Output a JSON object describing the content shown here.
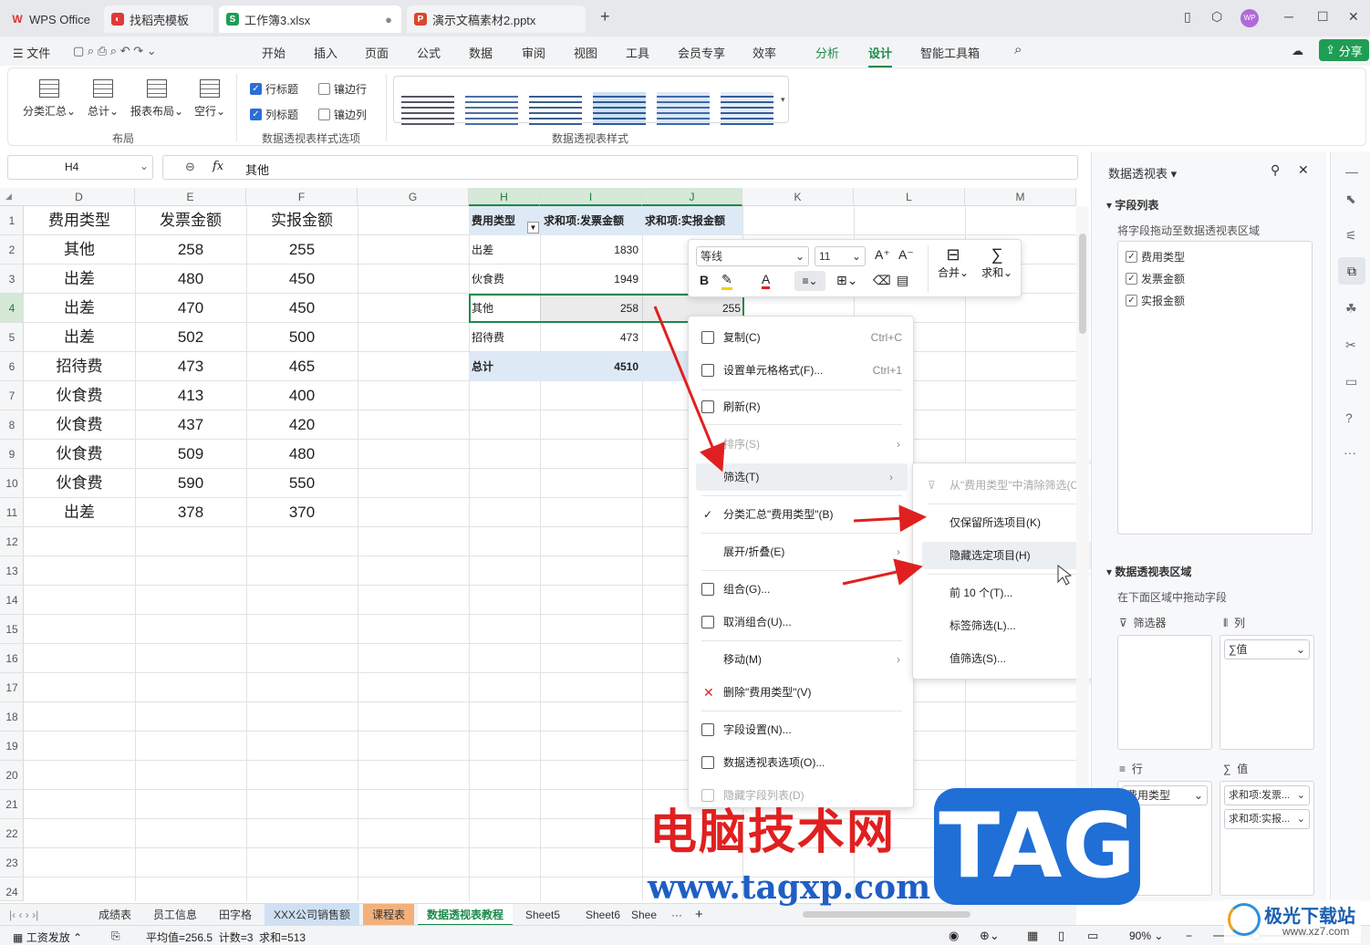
{
  "tabs": [
    {
      "label": "WPS Office"
    },
    {
      "label": "找稻壳模板"
    },
    {
      "label": "工作簿3.xlsx"
    },
    {
      "label": "演示文稿素材2.pptx"
    }
  ],
  "user_badge": "WP",
  "menus": [
    "文件",
    "开始",
    "插入",
    "页面",
    "公式",
    "数据",
    "审阅",
    "视图",
    "工具",
    "会员专享",
    "效率",
    "分析",
    "设计",
    "智能工具箱"
  ],
  "share": "分享",
  "ribbon": {
    "buttons": [
      "分类汇总",
      "总计",
      "报表布局",
      "空行"
    ],
    "group_layout": "布局",
    "checks": [
      {
        "label": "行标题",
        "on": true
      },
      {
        "label": "镶边行",
        "on": false
      },
      {
        "label": "列标题",
        "on": true
      },
      {
        "label": "镶边列",
        "on": false
      }
    ],
    "group_options": "数据透视表样式选项",
    "group_styles": "数据透视表样式"
  },
  "formula": {
    "cell": "H4",
    "fx": "fx",
    "value": "其他"
  },
  "columns": [
    "D",
    "E",
    "F",
    "G",
    "H",
    "I",
    "J",
    "K",
    "L",
    "M"
  ],
  "rows": [
    "1",
    "2",
    "3",
    "4",
    "5",
    "6",
    "7",
    "8",
    "9",
    "10",
    "11",
    "12",
    "13",
    "14",
    "15",
    "16",
    "17",
    "18",
    "19",
    "20",
    "21",
    "22",
    "23",
    "24"
  ],
  "table": [
    [
      "费用类型",
      "发票金额",
      "实报金额"
    ],
    [
      "其他",
      "258",
      "255"
    ],
    [
      "出差",
      "480",
      "450"
    ],
    [
      "出差",
      "470",
      "450"
    ],
    [
      "出差",
      "502",
      "500"
    ],
    [
      "招待费",
      "473",
      "465"
    ],
    [
      "伙食费",
      "413",
      "400"
    ],
    [
      "伙食费",
      "437",
      "420"
    ],
    [
      "伙食费",
      "509",
      "480"
    ],
    [
      "伙食费",
      "590",
      "550"
    ],
    [
      "出差",
      "378",
      "370"
    ]
  ],
  "pivot": {
    "headers": [
      "费用类型",
      "求和项:发票金额",
      "求和项:实报金额"
    ],
    "rows": [
      [
        "出差",
        "1830",
        ""
      ],
      [
        "伙食费",
        "1949",
        ""
      ],
      [
        "其他",
        "258",
        "255"
      ],
      [
        "招待费",
        "473",
        ""
      ],
      [
        "总计",
        "4510",
        ""
      ]
    ]
  },
  "mini": {
    "font": "等线",
    "size": "11",
    "merge": "合并",
    "sum": "求和"
  },
  "context_menu": [
    {
      "label": "复制(C)",
      "shortcut": "Ctrl+C"
    },
    {
      "label": "设置单元格格式(F)...",
      "shortcut": "Ctrl+1"
    },
    {
      "label": "刷新(R)",
      "shortcut": ""
    },
    {
      "label": "排序(S)",
      "shortcut": ""
    },
    {
      "label": "筛选(T)",
      "shortcut": ""
    },
    {
      "label": "分类汇总\"费用类型\"(B)",
      "shortcut": ""
    },
    {
      "label": "展开/折叠(E)",
      "shortcut": ""
    },
    {
      "label": "组合(G)...",
      "shortcut": ""
    },
    {
      "label": "取消组合(U)...",
      "shortcut": ""
    },
    {
      "label": "移动(M)",
      "shortcut": ""
    },
    {
      "label": "删除\"费用类型\"(V)",
      "shortcut": ""
    },
    {
      "label": "字段设置(N)...",
      "shortcut": ""
    },
    {
      "label": "数据透视表选项(O)...",
      "shortcut": ""
    },
    {
      "label": "隐藏字段列表(D)",
      "shortcut": ""
    }
  ],
  "submenu": [
    "从\"费用类型\"中清除筛选(C)",
    "仅保留所选项目(K)",
    "隐藏选定项目(H)",
    "前 10 个(T)...",
    "标签筛选(L)...",
    "值筛选(S)..."
  ],
  "panel": {
    "title": "数据透视表",
    "fields_title": "字段列表",
    "fields_hint": "将字段拖动至数据透视表区域",
    "fields": [
      "费用类型",
      "发票金额",
      "实报金额"
    ],
    "area_title": "数据透视表区域",
    "area_hint": "在下面区域中拖动字段",
    "filter": "筛选器",
    "col": "列",
    "col_item": "∑值",
    "row": "行",
    "val": "值",
    "row_item": "费用类型",
    "val_items": [
      "求和项:发票...",
      "求和项:实报..."
    ]
  },
  "sheets": [
    "成绩表",
    "员工信息",
    "田字格",
    "XXX公司销售额",
    "课程表",
    "数据透视表教程",
    "Sheet5",
    "Sheet6",
    "Shee"
  ],
  "status": {
    "mode": "工资发放",
    "stats": "平均值=256.5  计数=3  求和=513",
    "zoom": "90%"
  },
  "watermark": {
    "cn": "电脑技术网",
    "tag": "TAG",
    "url": "www.tagxp.com",
    "logo": "极光下载站",
    "logo_url": "www.xz7.com"
  },
  "colors": {
    "accent": "#1a8a4a",
    "pivot_header": "#dde9f5",
    "red": "#e02020"
  }
}
